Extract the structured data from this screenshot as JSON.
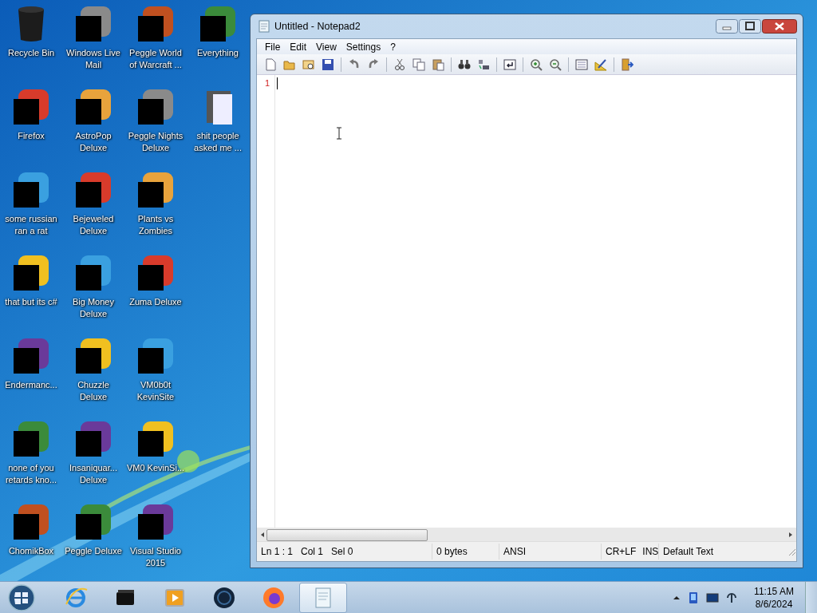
{
  "desktop": {
    "columns": [
      [
        {
          "label": "Recycle Bin",
          "kind": "bin"
        },
        {
          "label": "Firefox",
          "kind": "app"
        },
        {
          "label": "some russian ran a rat",
          "kind": "app"
        },
        {
          "label": "that but its c#",
          "kind": "app"
        },
        {
          "label": "Endermanc...",
          "kind": "app"
        },
        {
          "label": "none of you retards kno...",
          "kind": "app"
        },
        {
          "label": "ChomikBox",
          "kind": "app"
        }
      ],
      [
        {
          "label": "Windows Live Mail",
          "kind": "app"
        },
        {
          "label": "AstroPop Deluxe",
          "kind": "app"
        },
        {
          "label": "Bejeweled Deluxe",
          "kind": "app"
        },
        {
          "label": "Big Money Deluxe",
          "kind": "app"
        },
        {
          "label": "Chuzzle Deluxe",
          "kind": "app"
        },
        {
          "label": "Insaniquar... Deluxe",
          "kind": "app"
        },
        {
          "label": "Peggle Deluxe",
          "kind": "app"
        }
      ],
      [
        {
          "label": "Peggle World of Warcraft ...",
          "kind": "app"
        },
        {
          "label": "Peggle Nights Deluxe",
          "kind": "app"
        },
        {
          "label": "Plants vs Zombies",
          "kind": "app"
        },
        {
          "label": "Zuma Deluxe",
          "kind": "app"
        },
        {
          "label": "VM0b0t KevinSite",
          "kind": "app"
        },
        {
          "label": "VM0 KevinSi...",
          "kind": "app"
        },
        {
          "label": "Visual Studio 2015",
          "kind": "app"
        }
      ],
      [
        {
          "label": "Everything",
          "kind": "app"
        },
        {
          "label": "shit people asked me ...",
          "kind": "folder"
        }
      ]
    ]
  },
  "window": {
    "title": "Untitled - Notepad2",
    "menu": [
      "File",
      "Edit",
      "View",
      "Settings",
      "?"
    ],
    "editor": {
      "line_numbers": [
        "1"
      ]
    },
    "status_bar": [
      "Ln 1 : 1",
      "Col 1",
      "Sel 0",
      "0 bytes",
      "ANSI",
      "CR+LF",
      "INS",
      "Default Text"
    ]
  },
  "taskbar": {
    "items": [
      {
        "kind": "ie",
        "active": false
      },
      {
        "kind": "box",
        "active": false
      },
      {
        "kind": "media",
        "active": false
      },
      {
        "kind": "globe",
        "active": false
      },
      {
        "kind": "firefox",
        "active": false
      },
      {
        "kind": "notepad",
        "active": true
      }
    ],
    "clock": {
      "time": "11:15 AM",
      "date": "8/6/2024"
    }
  }
}
